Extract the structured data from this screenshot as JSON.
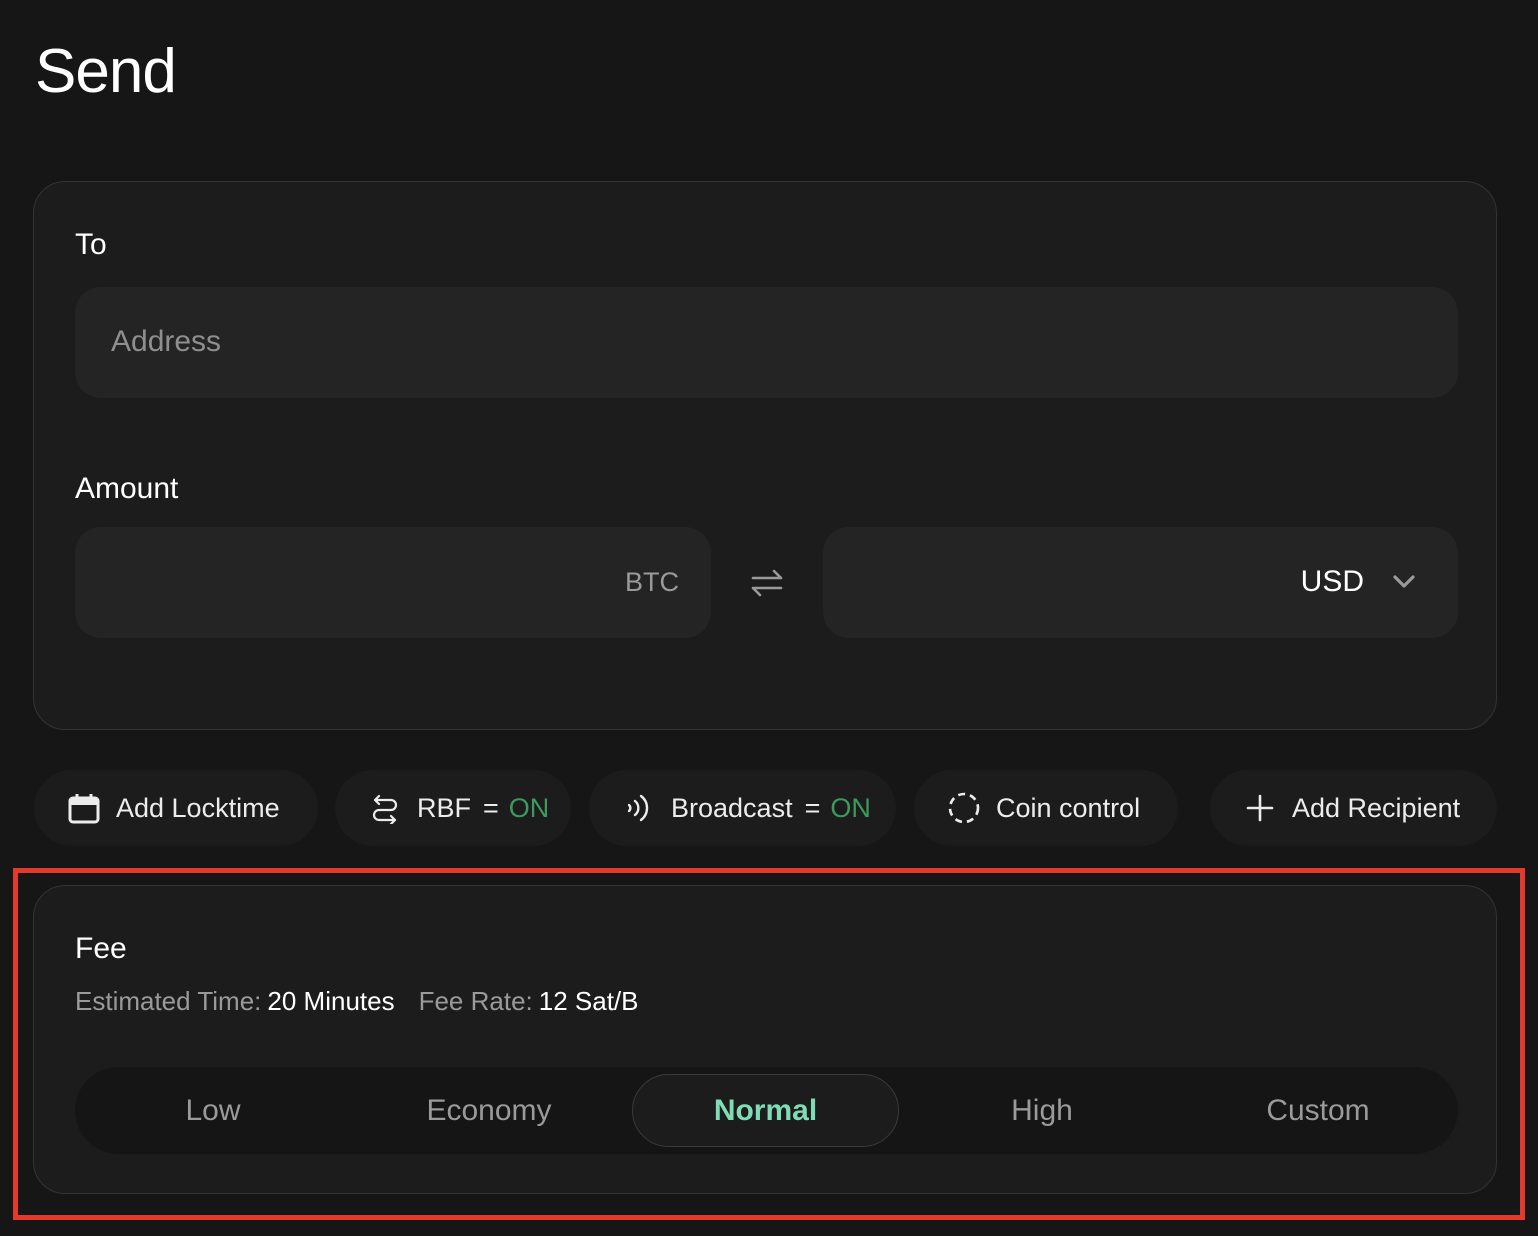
{
  "page": {
    "title": "Send"
  },
  "recipient": {
    "label": "To",
    "address_placeholder": "Address",
    "address_value": ""
  },
  "amount": {
    "label": "Amount",
    "btc_value": "",
    "btc_unit": "BTC",
    "fiat_value": "",
    "fiat_currency": "USD",
    "swap_icon": "swap-arrows-icon",
    "dropdown_icon": "chevron-down-icon"
  },
  "actions": [
    {
      "icon": "calendar-icon",
      "label": "Add Locktime"
    },
    {
      "icon": "repeat-arrows-icon",
      "label": "RBF",
      "state": "ON"
    },
    {
      "icon": "broadcast-icon",
      "label": "Broadcast",
      "state": "ON"
    },
    {
      "icon": "dashed-circle-icon",
      "label": "Coin control"
    },
    {
      "icon": "plus-icon",
      "label": "Add Recipient"
    }
  ],
  "fee": {
    "label": "Fee",
    "estimated_time_label": "Estimated Time:",
    "estimated_time_value": "20 Minutes",
    "fee_rate_label": "Fee Rate:",
    "fee_rate_value": "12 Sat/B",
    "options": [
      "Low",
      "Economy",
      "Normal",
      "High",
      "Custom"
    ],
    "selected": "Normal"
  },
  "colors": {
    "on_state": "#3d9a5c",
    "selected_fee": "#7fdcb4",
    "highlight_box": "#e33a2c"
  }
}
